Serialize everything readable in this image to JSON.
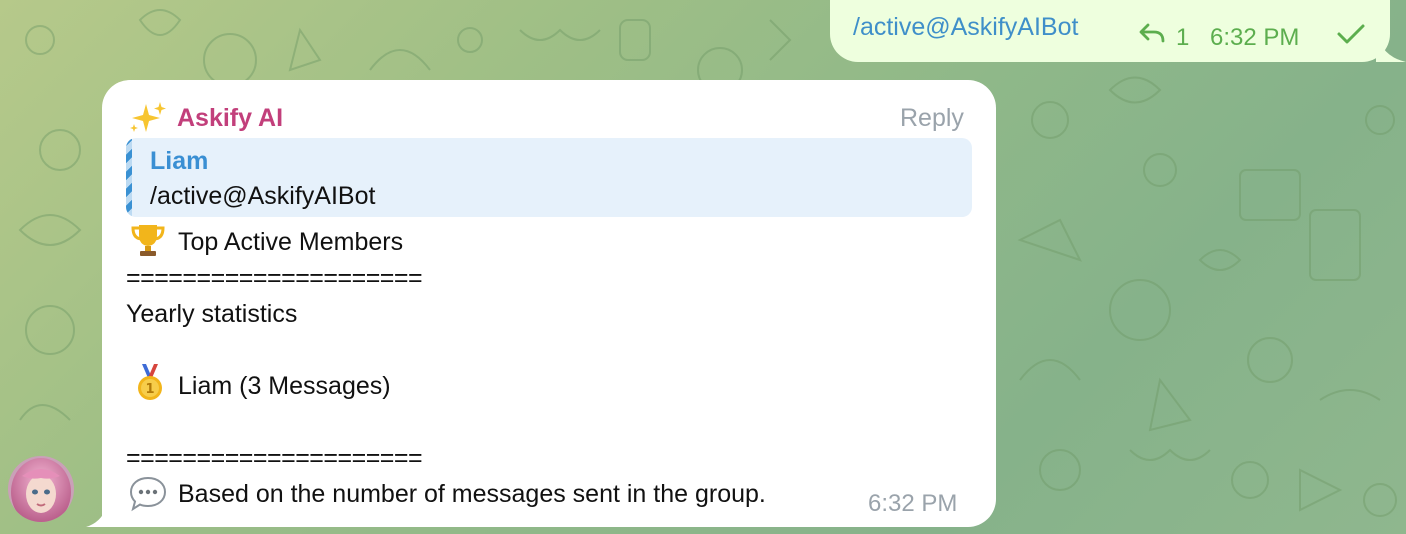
{
  "outgoing": {
    "text": "/active@AskifyAIBot",
    "reply_count": "1",
    "time": "6:32 PM",
    "status_icon": "check-icon",
    "reply_icon": "reply-arrow-icon"
  },
  "incoming": {
    "sender_name": "Askify AI",
    "sender_icon": "sparkles-icon",
    "reply_label": "Reply",
    "quote": {
      "author": "Liam",
      "text": "/active@AskifyAIBot"
    },
    "title": "Top Active Members",
    "title_icon": "trophy-icon",
    "separator": "=====================",
    "subtitle": "Yearly statistics",
    "ranking": [
      {
        "icon": "first-place-medal-icon",
        "text": "Liam (3 Messages)"
      }
    ],
    "footnote": "Based on the number of messages sent in the group.",
    "footnote_icon": "speech-bubble-icon",
    "time": "6:32 PM"
  },
  "colors": {
    "sender_name": "#c23f7b",
    "link_blue": "#3f8fc9",
    "outgoing_meta": "#5cae4e",
    "outgoing_bubble": "#eeffde"
  }
}
